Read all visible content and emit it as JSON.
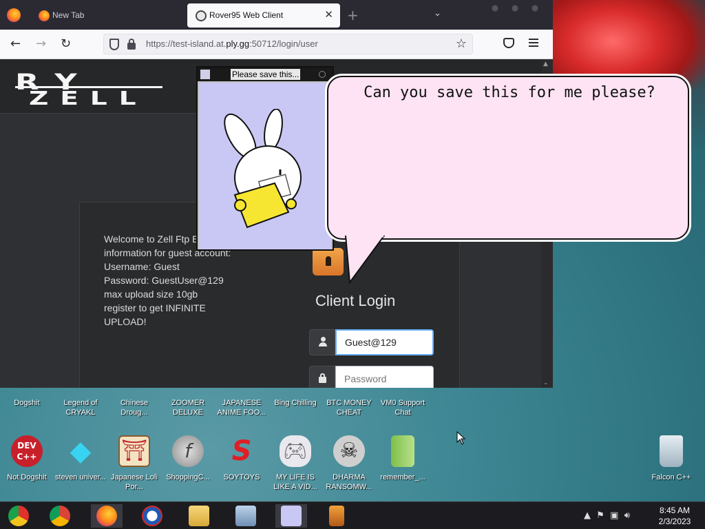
{
  "browser": {
    "tabs": [
      {
        "label": "New Tab"
      },
      {
        "label": "Rover95 Web Client"
      }
    ],
    "url_prefix": "https://test-island.at.",
    "url_domain": "ply.gg",
    "url_suffix": ":50712/login/user"
  },
  "site": {
    "logo_top": "RY",
    "logo_bottom": "ZELL",
    "welcome_lines": [
      "Welcome to Zell Ftp E",
      "information for guest account:",
      "Username: Guest",
      "Password: GuestUser@129",
      "max upload size 10gb",
      "register to get INFINITE",
      "UPLOAD!"
    ],
    "login_title": "Client Login",
    "username_value": "Guest@129",
    "password_placeholder": "Password"
  },
  "popup": {
    "title": "Please save this..."
  },
  "bubble": {
    "text": "Can you save this for me please?"
  },
  "desktop": {
    "top_row": [
      {
        "label": "Dogshit"
      },
      {
        "label": "Legend of CRYAKL"
      },
      {
        "label": "Chinese Droug..."
      },
      {
        "label": "ZOOMER DELUXE"
      },
      {
        "label": "JAPANESE ANIME FOO..."
      },
      {
        "label": "Bing Chilling"
      },
      {
        "label": "BTC MONEY CHEAT"
      },
      {
        "label": "VM0 Support Chat"
      }
    ],
    "bottom_row": [
      {
        "label": "Not Dogshit"
      },
      {
        "label": "steven univer..."
      },
      {
        "label": "Japanese Loli Por..."
      },
      {
        "label": "ShoppingC..."
      },
      {
        "label": "SOYTOYS"
      },
      {
        "label": "MY LIFE IS LIKE A VID..."
      },
      {
        "label": "DHARMA RANSOMW..."
      },
      {
        "label": "remember_..."
      }
    ],
    "recycle_bin": "Falcon C++"
  },
  "taskbar": {
    "time": "8:45 AM",
    "date": "2/3/2023"
  }
}
